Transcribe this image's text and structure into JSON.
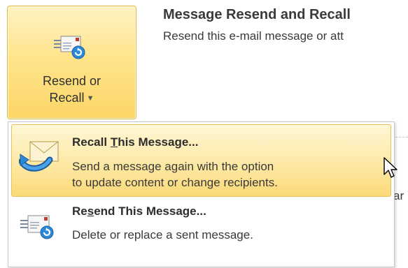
{
  "ribbon_button": {
    "label_line1": "Resend or",
    "label_line2": "Recall",
    "arrow_icon": "chevron-down-icon",
    "icon": "envelope-resend-icon"
  },
  "group_info": {
    "title": "Message Resend and Recall",
    "description": "Resend this e-mail message or att"
  },
  "background": {
    "fragment_text": "ar"
  },
  "menu": {
    "items": [
      {
        "title_before": "Recall ",
        "title_underlined": "T",
        "title_after": "his Message...",
        "desc_line1": "Send a message again with the option",
        "desc_line2": "to update content or change recipients.",
        "icon": "envelope-recall-icon",
        "highlighted": true
      },
      {
        "title_before": "Re",
        "title_underlined": "s",
        "title_after": "end This Message...",
        "desc_line1": "Delete or replace a sent message.",
        "icon": "envelope-resend-icon",
        "highlighted": false
      }
    ]
  },
  "colors": {
    "highlight_fill": "#fde7a0",
    "highlight_border": "#e6c35a",
    "accent_blue": "#2a8ad8",
    "envelope_red": "#c23b2e"
  }
}
